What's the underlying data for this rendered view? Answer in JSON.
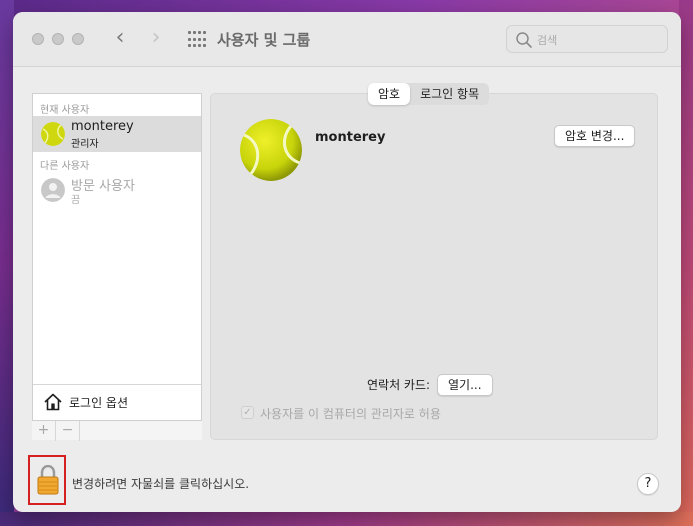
{
  "window": {
    "title": "사용자 및 그룹",
    "back_glyph": "‹",
    "forward_glyph": "›"
  },
  "search": {
    "placeholder": "검색",
    "value": ""
  },
  "users_panel": {
    "current_section_label": "현재 사용자",
    "current_user": {
      "name": "monterey",
      "role": "관리자",
      "avatar_icon": "tennis-ball-icon"
    },
    "other_section_label": "다른 사용자",
    "guest_user": {
      "name": "방문 사용자",
      "status": "끔",
      "avatar_icon": "person-icon"
    },
    "login_options_label": "로그인 옵션",
    "add_glyph": "+",
    "remove_glyph": "−"
  },
  "detail": {
    "tabs": [
      {
        "label": "암호",
        "active": true
      },
      {
        "label": "로그인 항목",
        "active": false
      }
    ],
    "user_name": "monterey",
    "change_password_label": "암호 변경...",
    "contact_card_label": "연락처 카드:",
    "open_label": "열기...",
    "allow_admin_label": "사용자를 이 컴퓨터의 관리자로 허용",
    "allow_admin_checked": true,
    "check_glyph": "✓"
  },
  "footer": {
    "lock_text": "변경하려면 자물쇠를 클릭하십시오.",
    "help_glyph": "?"
  },
  "colors": {
    "window_bg": "#ececec",
    "selection_bg": "#dcdcdc",
    "lock_highlight": "#d42020",
    "tennis_ball": "#d4e010"
  }
}
